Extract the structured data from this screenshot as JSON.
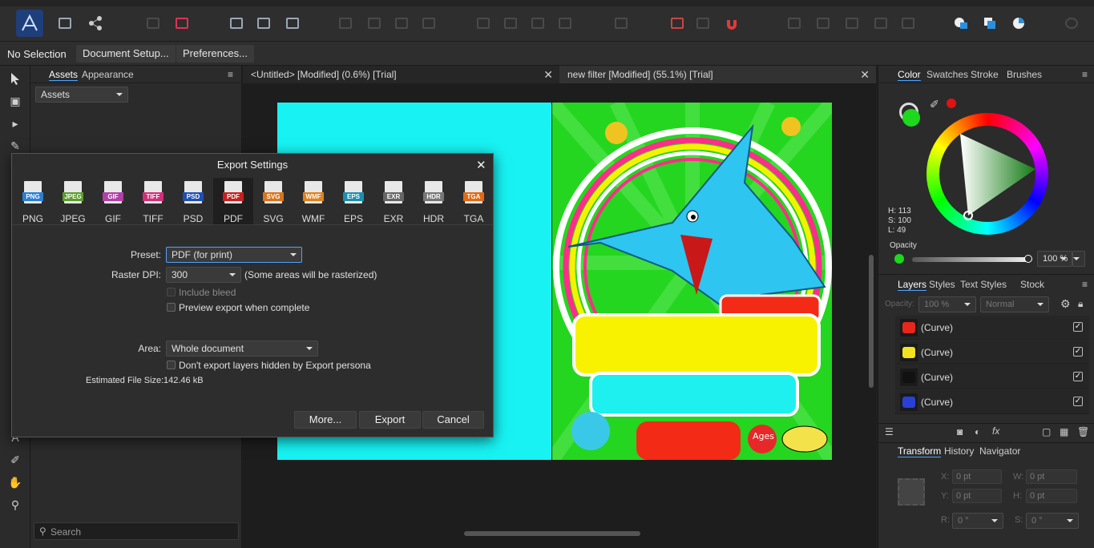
{
  "context_bar": {
    "no_selection": "No Selection",
    "document_setup": "Document Setup...",
    "preferences": "Preferences..."
  },
  "left_panel": {
    "tab_assets": "Assets",
    "tab_appearance": "Appearance",
    "assets_dropdown": "Assets",
    "search_placeholder": "Search"
  },
  "doc_tabs": [
    {
      "label": "<Untitled> [Modified] (0.6%) [Trial]"
    },
    {
      "label": "new filter [Modified] (55.1%) [Trial]"
    }
  ],
  "color_panel": {
    "tabs": [
      "Color",
      "Swatches",
      "Stroke",
      "Brushes"
    ],
    "h": "H: 113",
    "s": "S: 100",
    "l": "L: 49",
    "opacity_label": "Opacity",
    "opacity_value": "100 %",
    "current_color": "#1dd81d"
  },
  "layers_panel": {
    "tabs": [
      "Layers",
      "Styles",
      "Text Styles",
      "Stock"
    ],
    "opacity_label": "Opacity:",
    "opacity_value": "100 %",
    "blend": "Normal",
    "rows": [
      {
        "name": "(Curve)",
        "color": "#e8261c",
        "checked": "✓"
      },
      {
        "name": "(Curve)",
        "color": "#f3e31c",
        "checked": "✓"
      },
      {
        "name": "(Curve)",
        "color": "#111111",
        "checked": "✓"
      },
      {
        "name": "(Curve)",
        "color": "#2a3fd6",
        "checked": "✓"
      }
    ]
  },
  "transform_panel": {
    "tabs": [
      "Transform",
      "History",
      "Navigator"
    ],
    "x_label": "X:",
    "x": "0 pt",
    "w_label": "W:",
    "w": "0 pt",
    "y_label": "Y:",
    "y": "0 pt",
    "h_label": "H:",
    "h": "0 pt",
    "r_label": "R:",
    "r": "0 °",
    "s_label": "S:",
    "s": "0 °"
  },
  "export_dialog": {
    "title": "Export Settings",
    "formats": [
      {
        "label": "PNG",
        "color": "#2a7fd4"
      },
      {
        "label": "JPEG",
        "color": "#5a9e2a"
      },
      {
        "label": "GIF",
        "color": "#b23fa8"
      },
      {
        "label": "TIFF",
        "color": "#d12e7a"
      },
      {
        "label": "PSD",
        "color": "#1e4fb4"
      },
      {
        "label": "PDF",
        "color": "#c62020"
      },
      {
        "label": "SVG",
        "color": "#d9741a"
      },
      {
        "label": "WMF",
        "color": "#e0821a"
      },
      {
        "label": "EPS",
        "color": "#1a8fb0"
      },
      {
        "label": "EXR",
        "color": "#666666"
      },
      {
        "label": "HDR",
        "color": "#777777"
      },
      {
        "label": "TGA",
        "color": "#e06a14"
      }
    ],
    "preset_label": "Preset:",
    "preset_value": "PDF (for print)",
    "dpi_label": "Raster DPI:",
    "dpi_value": "300",
    "dpi_note": "(Some areas will be rasterized)",
    "include_bleed": "Include bleed",
    "preview_export": "Preview export when complete",
    "area_label": "Area:",
    "area_value": "Whole document",
    "dont_export": "Don't export layers hidden by Export persona",
    "file_size_label": "Estimated File Size:",
    "file_size_value": "142.46 kB",
    "more": "More...",
    "export": "Export",
    "cancel": "Cancel"
  }
}
